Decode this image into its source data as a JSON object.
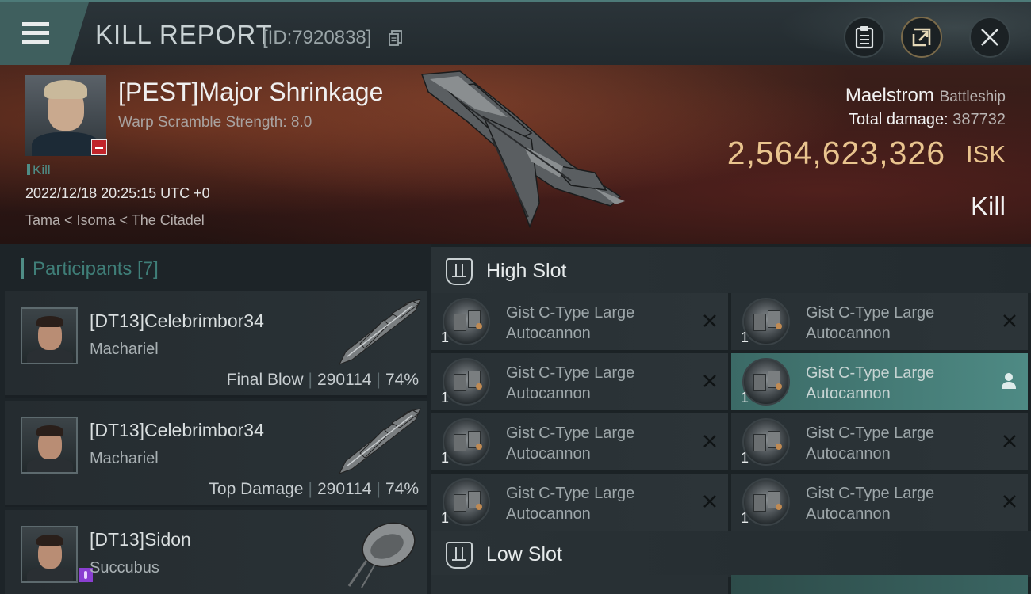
{
  "header": {
    "title": "KILL REPORT",
    "report_id": "[ID:7920838]",
    "icons": [
      "menu-icon",
      "copy-icon",
      "clipboard-icon",
      "share-icon",
      "close-icon"
    ]
  },
  "victim": {
    "name": "[PEST]Major Shrinkage",
    "warp_scramble": "Warp Scramble Strength: 8.0",
    "kill_tag": "Kill",
    "time": "2022/12/18 20:25:15 UTC +0",
    "location": "Tama < Isoma < The Citadel",
    "ship_name": "Maelstrom",
    "ship_class": "Battleship",
    "total_damage_label": "Total damage:",
    "total_damage_value": "387732",
    "isk_value": "2,564,623,326",
    "isk_unit": "ISK",
    "result": "Kill"
  },
  "participants": {
    "title": "Participants [7]",
    "items": [
      {
        "name": "[DT13]Celebrimbor34",
        "ship": "Machariel",
        "tag": "Final Blow",
        "damage": "290114",
        "percent": "74%"
      },
      {
        "name": "[DT13]Celebrimbor34",
        "ship": "Machariel",
        "tag": "Top Damage",
        "damage": "290114",
        "percent": "74%"
      },
      {
        "name": "[DT13]Sidon",
        "ship": "Succubus",
        "tag": "",
        "damage": "",
        "percent": ""
      }
    ]
  },
  "fittings": {
    "high_slot_title": "High Slot",
    "low_slot_title": "Low Slot",
    "high_slots": [
      {
        "line1": "Gist C-Type Large",
        "line2": "Autocannon",
        "qty": "1"
      },
      {
        "line1": "Gist C-Type Large",
        "line2": "Autocannon",
        "qty": "1"
      },
      {
        "line1": "Gist C-Type Large",
        "line2": "Autocannon",
        "qty": "1"
      },
      {
        "line1": "Gist C-Type Large",
        "line2": "Autocannon",
        "qty": "1"
      },
      {
        "line1": "Gist C-Type Large",
        "line2": "Autocannon",
        "qty": "1"
      },
      {
        "line1": "Gist C-Type Large",
        "line2": "Autocannon",
        "qty": "1"
      },
      {
        "line1": "Gist C-Type Large",
        "line2": "Autocannon",
        "qty": "1"
      },
      {
        "line1": "Gist C-Type Large",
        "line2": "Autocannon",
        "qty": "1"
      }
    ]
  },
  "colors": {
    "accent": "#4f8d86",
    "isk_gold": "#e9c48e",
    "victim_badge": "#c0242a",
    "active_slot": "#4e8a84"
  }
}
